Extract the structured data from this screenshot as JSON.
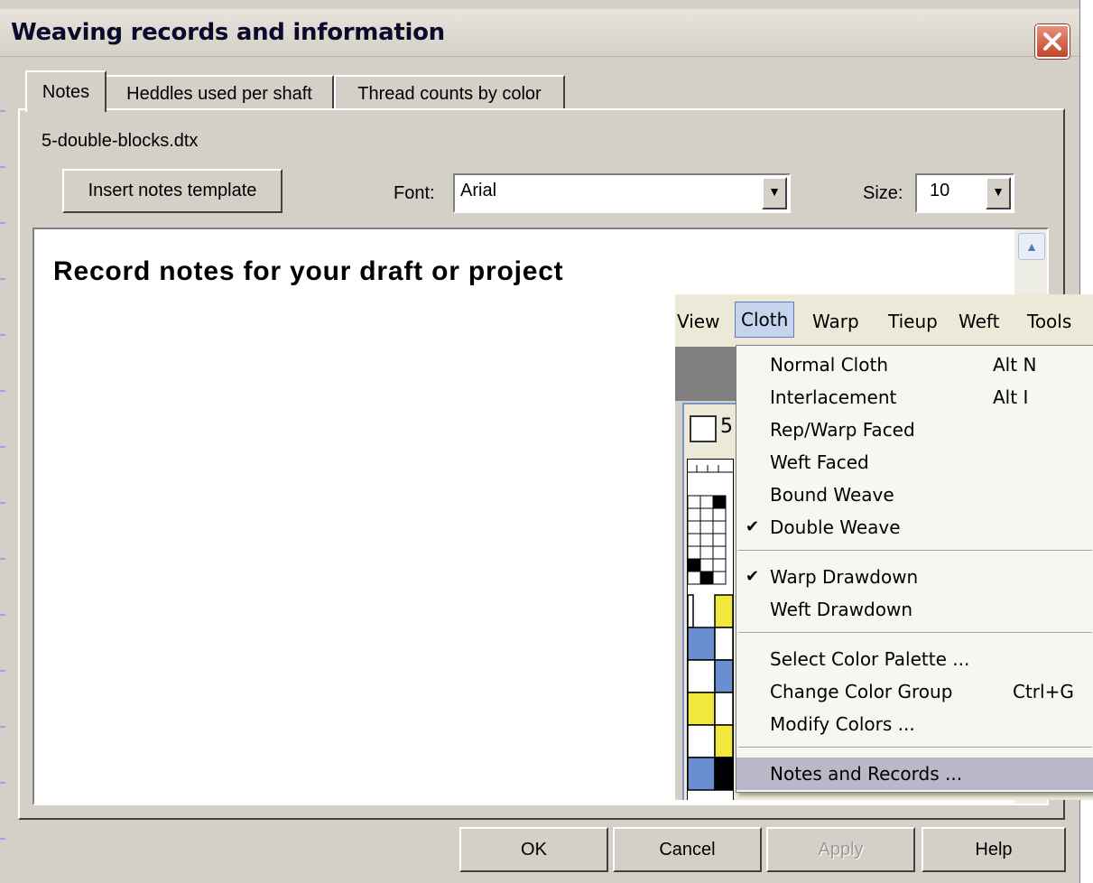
{
  "dialog": {
    "title": "Weaving records and information",
    "close_icon": "close-x-icon"
  },
  "tabs": [
    {
      "label": "Notes",
      "active": true
    },
    {
      "label": "Heddles used per shaft",
      "active": false
    },
    {
      "label": "Thread counts by color",
      "active": false
    }
  ],
  "notes_tab": {
    "filename": "5-double-blocks.dtx",
    "insert_button": "Insert notes template",
    "font_label": "Font:",
    "font_value": "Arial",
    "size_label": "Size:",
    "size_value": "10",
    "notes_text": "Record notes for your draft or project"
  },
  "background_app": {
    "menubar": [
      "View",
      "Cloth",
      "Warp",
      "Tieup",
      "Weft",
      "Tools"
    ],
    "active_menu": "Cloth",
    "child_window_title": "5",
    "grid_colors": {
      "yellow": "#f0e83c",
      "blue": "#6a8fd0",
      "black": "#000000"
    }
  },
  "cloth_menu": {
    "items": [
      {
        "label": "Normal Cloth",
        "shortcut": "Alt N",
        "checked": false
      },
      {
        "label": "Interlacement",
        "shortcut": "Alt I",
        "checked": false
      },
      {
        "label": "Rep/Warp Faced",
        "shortcut": "",
        "checked": false
      },
      {
        "label": "Weft Faced",
        "shortcut": "",
        "checked": false
      },
      {
        "label": "Bound Weave",
        "shortcut": "",
        "checked": false
      },
      {
        "label": "Double Weave",
        "shortcut": "",
        "checked": true
      },
      {
        "label": "Warp Drawdown",
        "shortcut": "",
        "checked": true
      },
      {
        "label": "Weft Drawdown",
        "shortcut": "",
        "checked": false
      },
      {
        "label": "Select Color Palette ...",
        "shortcut": "",
        "checked": false
      },
      {
        "label": "Change Color Group",
        "shortcut": "Ctrl+G",
        "checked": false
      },
      {
        "label": "Modify Colors ...",
        "shortcut": "",
        "checked": false
      },
      {
        "label": "Notes and Records ...",
        "shortcut": "",
        "checked": false,
        "highlighted": true
      }
    ]
  },
  "buttons": {
    "ok": "OK",
    "cancel": "Cancel",
    "apply": "Apply",
    "help": "Help"
  }
}
